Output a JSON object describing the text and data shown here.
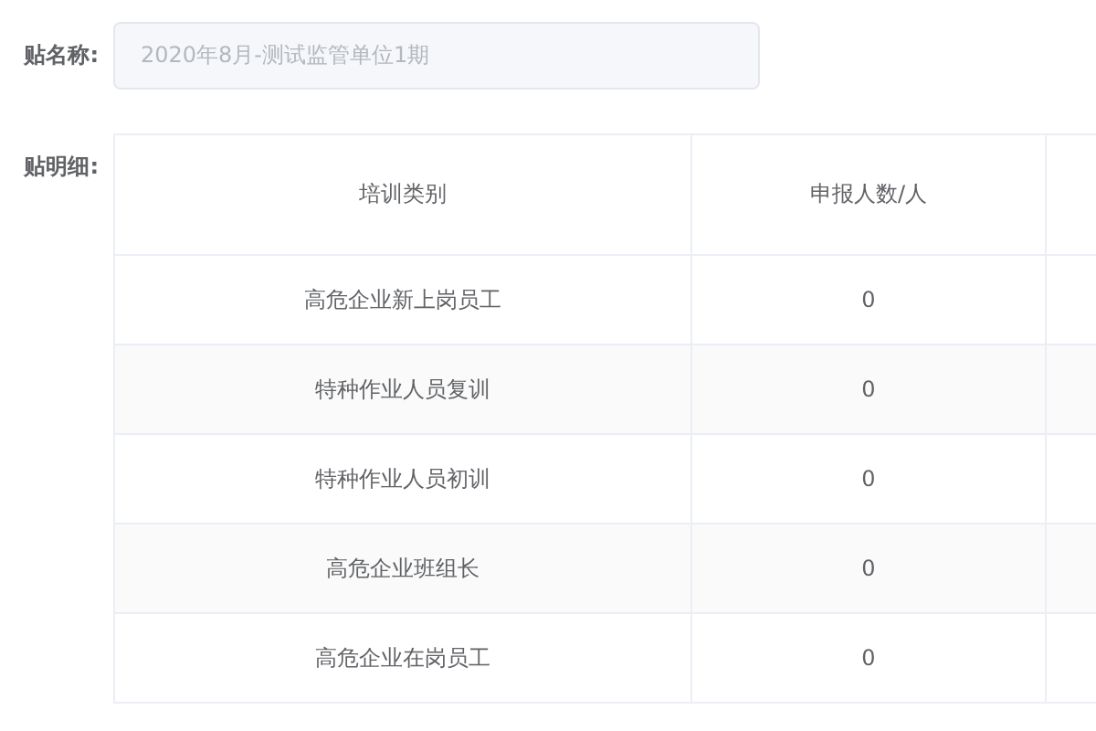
{
  "form": {
    "name_label": "贴名称:",
    "name_value": "2020年8月-测试监管单位1期",
    "detail_label": "贴明细:"
  },
  "table": {
    "columns": [
      "培训类别",
      "申报人数/人"
    ],
    "rows": [
      {
        "category": "高危企业新上岗员工",
        "count": "0"
      },
      {
        "category": "特种作业人员复训",
        "count": "0"
      },
      {
        "category": "特种作业人员初训",
        "count": "0"
      },
      {
        "category": "高危企业班组长",
        "count": "0"
      },
      {
        "category": "高危企业在岗员工",
        "count": "0"
      }
    ]
  }
}
